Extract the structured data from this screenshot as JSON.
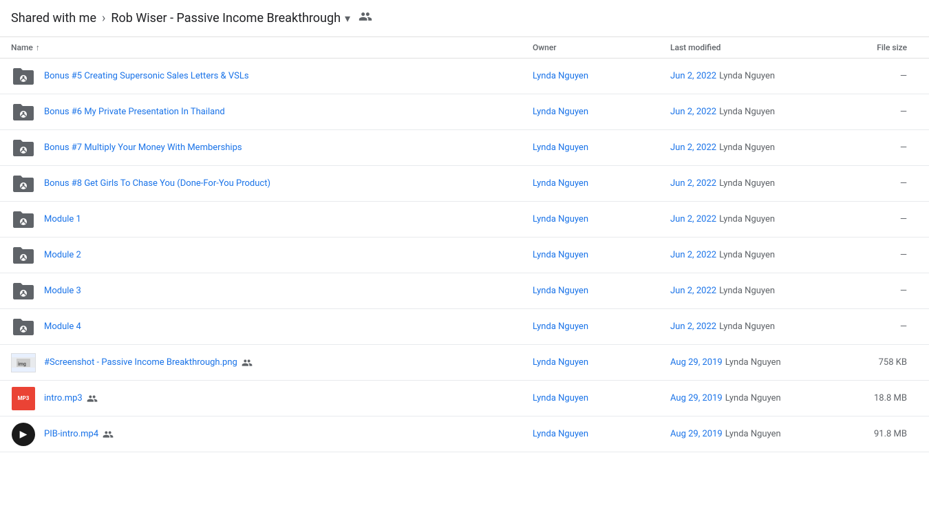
{
  "breadcrumb": {
    "shared_with_me": "Shared with me",
    "current_folder": "Rob Wiser - Passive Income Breakthrough"
  },
  "columns": {
    "name": "Name",
    "owner": "Owner",
    "last_modified": "Last modified",
    "file_size": "File size"
  },
  "rows": [
    {
      "id": 1,
      "type": "folder-shared",
      "name": "Bonus #5 Creating Supersonic Sales Letters & VSLs",
      "owner": "Lynda Nguyen",
      "date": "Jun 2, 2022",
      "modified_by": "Lynda Nguyen",
      "size": "—",
      "shared": false
    },
    {
      "id": 2,
      "type": "folder-shared",
      "name": "Bonus #6 My Private Presentation In Thailand",
      "owner": "Lynda Nguyen",
      "date": "Jun 2, 2022",
      "modified_by": "Lynda Nguyen",
      "size": "—",
      "shared": false
    },
    {
      "id": 3,
      "type": "folder-shared",
      "name": "Bonus #7 Multiply Your Money With Memberships",
      "owner": "Lynda Nguyen",
      "date": "Jun 2, 2022",
      "modified_by": "Lynda Nguyen",
      "size": "—",
      "shared": false
    },
    {
      "id": 4,
      "type": "folder-shared",
      "name": "Bonus #8 Get Girls To Chase You (Done-For-You Product)",
      "owner": "Lynda Nguyen",
      "date": "Jun 2, 2022",
      "modified_by": "Lynda Nguyen",
      "size": "—",
      "shared": false
    },
    {
      "id": 5,
      "type": "folder-shared",
      "name": "Module 1",
      "owner": "Lynda Nguyen",
      "date": "Jun 2, 2022",
      "modified_by": "Lynda Nguyen",
      "size": "—",
      "shared": false
    },
    {
      "id": 6,
      "type": "folder-shared",
      "name": "Module 2",
      "owner": "Lynda Nguyen",
      "date": "Jun 2, 2022",
      "modified_by": "Lynda Nguyen",
      "size": "—",
      "shared": false
    },
    {
      "id": 7,
      "type": "folder-shared",
      "name": "Module 3",
      "owner": "Lynda Nguyen",
      "date": "Jun 2, 2022",
      "modified_by": "Lynda Nguyen",
      "size": "—",
      "shared": false
    },
    {
      "id": 8,
      "type": "folder-shared",
      "name": "Module 4",
      "owner": "Lynda Nguyen",
      "date": "Jun 2, 2022",
      "modified_by": "Lynda Nguyen",
      "size": "—",
      "shared": false
    },
    {
      "id": 9,
      "type": "png",
      "name": "#Screenshot - Passive Income Breakthrough.png",
      "owner": "Lynda Nguyen",
      "date": "Aug 29, 2019",
      "modified_by": "Lynda Nguyen",
      "size": "758 KB",
      "shared": true
    },
    {
      "id": 10,
      "type": "mp3",
      "name": "intro.mp3",
      "owner": "Lynda Nguyen",
      "date": "Aug 29, 2019",
      "modified_by": "Lynda Nguyen",
      "size": "18.8 MB",
      "shared": true
    },
    {
      "id": 11,
      "type": "mp4",
      "name": "PIB-intro.mp4",
      "owner": "Lynda Nguyen",
      "date": "Aug 29, 2019",
      "modified_by": "Lynda Nguyen",
      "size": "91.8 MB",
      "shared": true
    }
  ]
}
